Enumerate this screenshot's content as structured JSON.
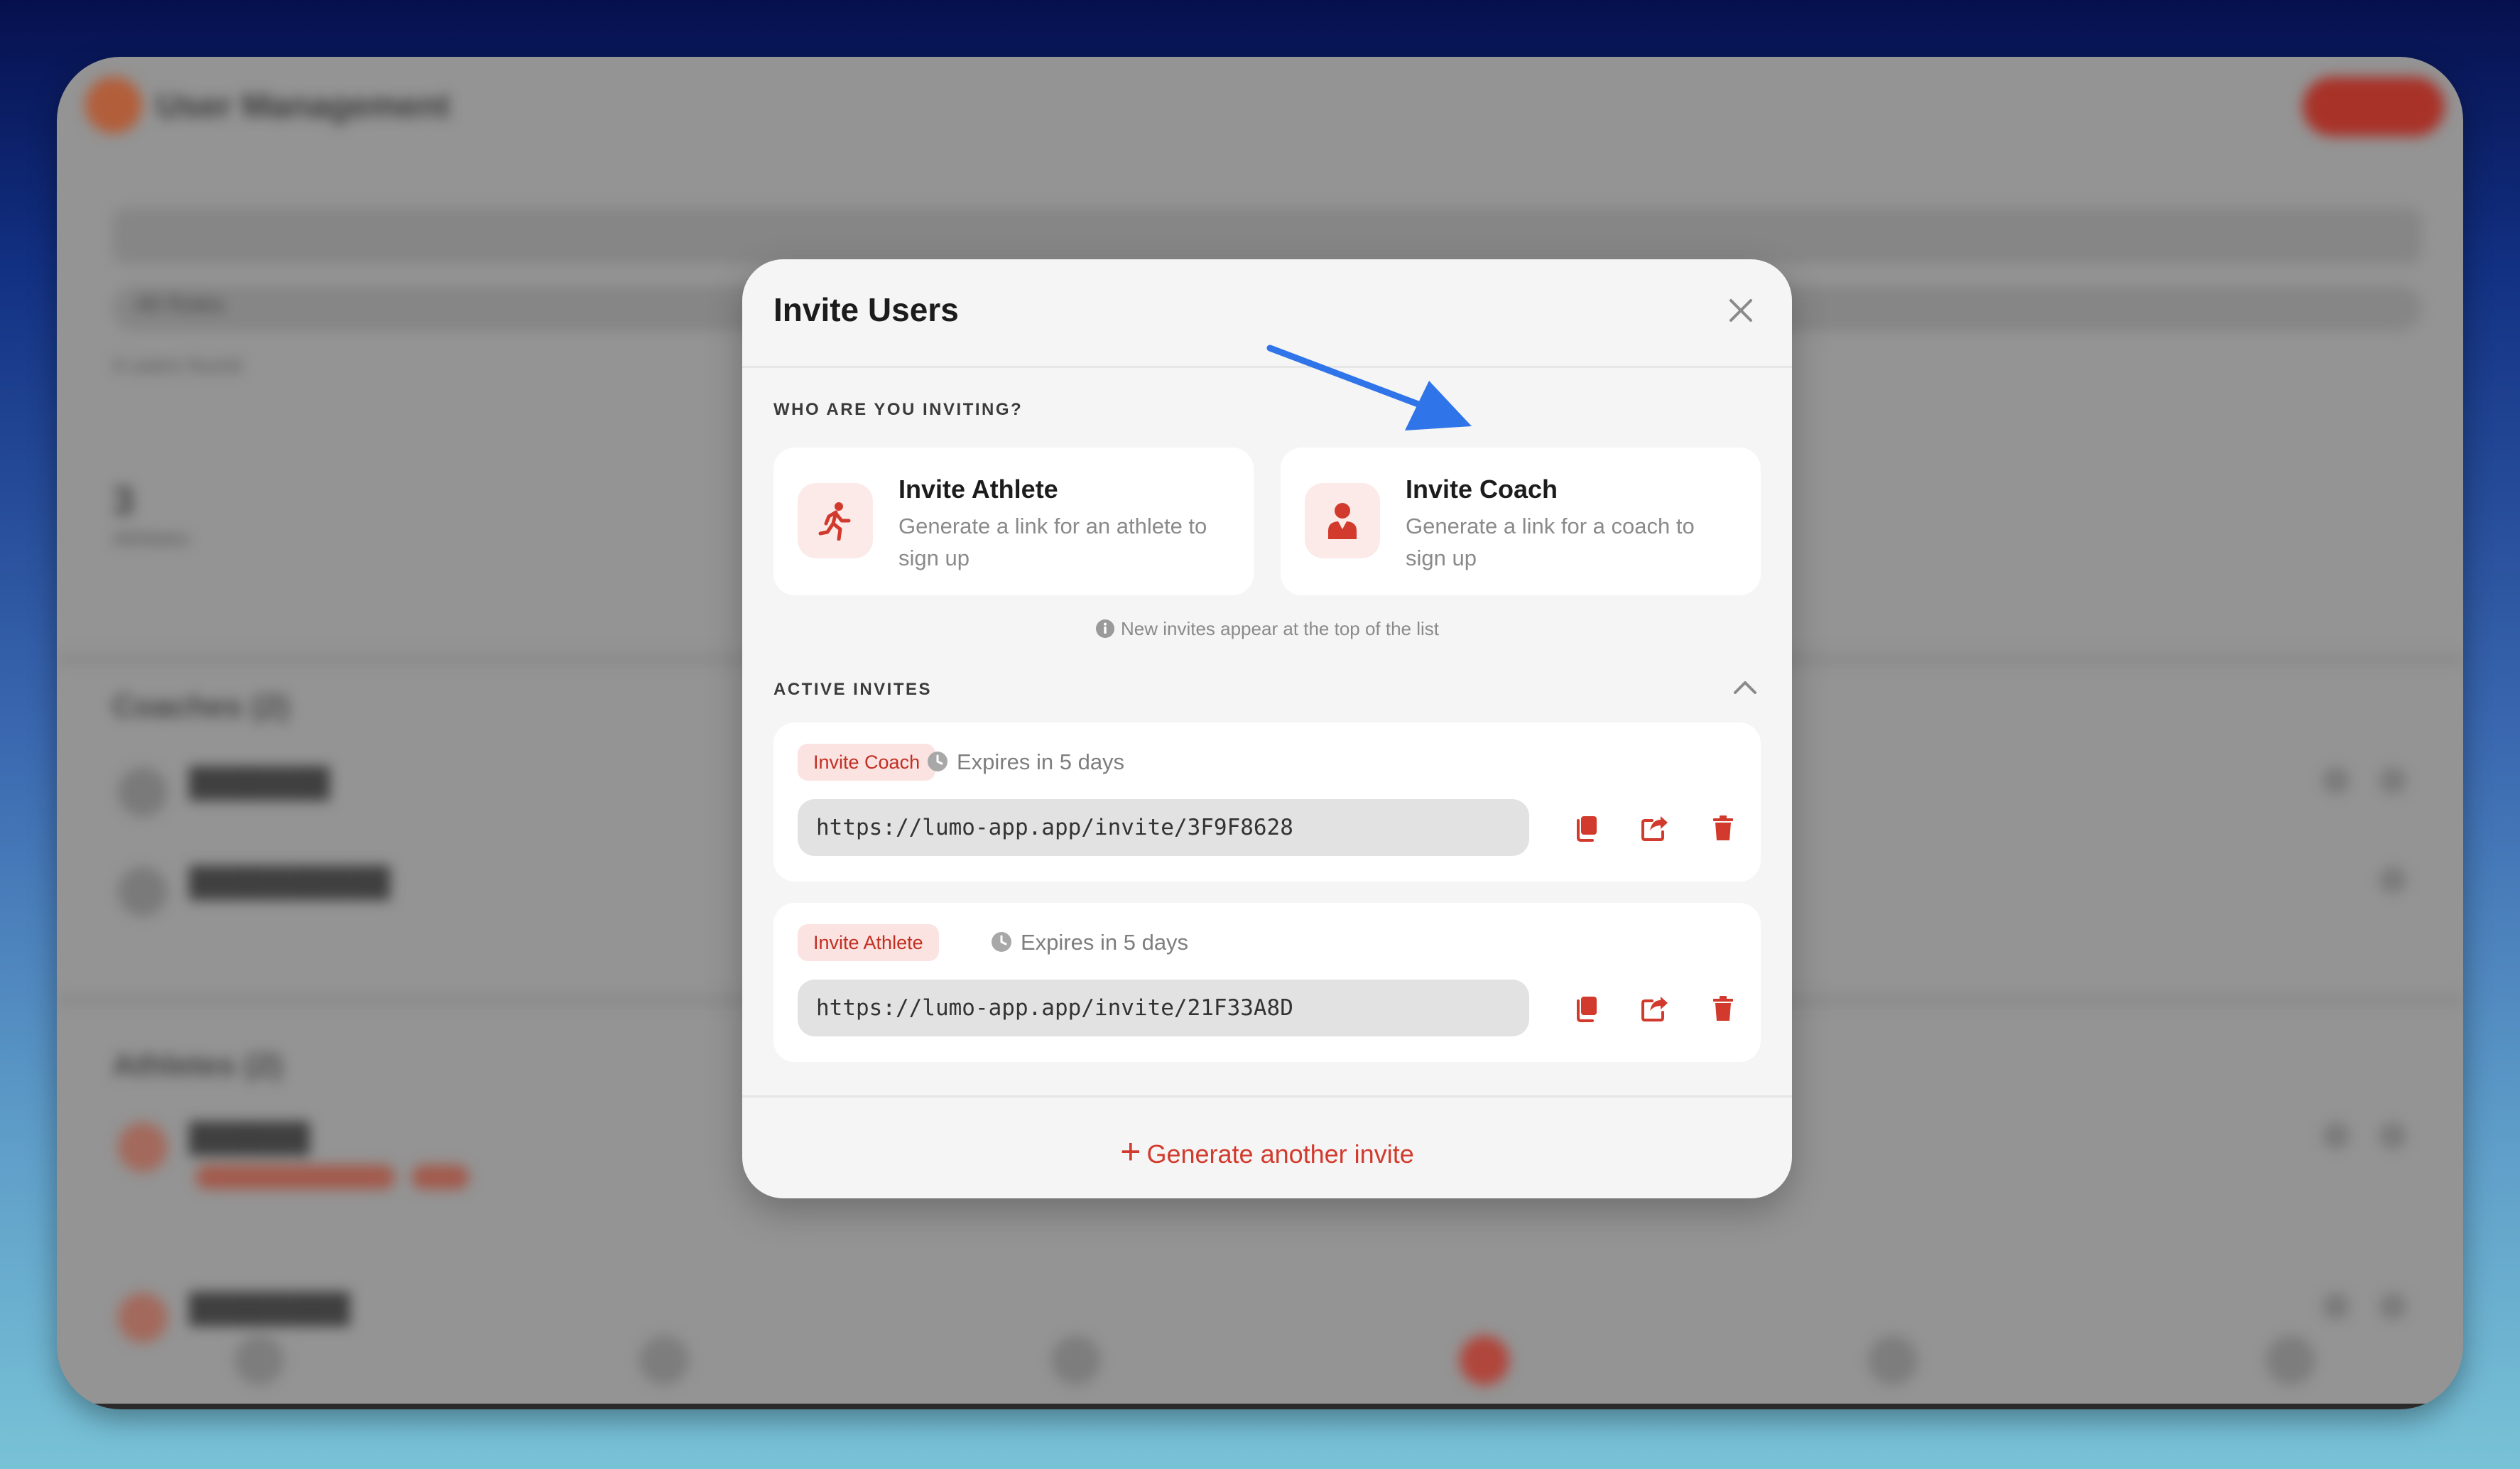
{
  "background_app": {
    "title": "User Management",
    "filter_label": "All Roles",
    "count_label": "4 users found",
    "stat_value": "3",
    "stat_label": "Athletes",
    "coaches_section": "Coaches (2)",
    "athletes_section": "Athletes (2)"
  },
  "modal": {
    "title": "Invite Users",
    "section_label": "WHO ARE YOU INVITING?",
    "choices": [
      {
        "title": "Invite Athlete",
        "description": "Generate a link for an athlete to sign up",
        "icon": "running-person-icon"
      },
      {
        "title": "Invite Coach",
        "description": "Generate a link for a coach to sign up",
        "icon": "person-icon"
      }
    ],
    "hint": "New invites appear at the top of the list",
    "active_label": "ACTIVE INVITES",
    "invites": [
      {
        "tag": "Invite Coach",
        "expires": "Expires in 5 days",
        "url": "https://lumo-app.app/invite/3F9F8628"
      },
      {
        "tag": "Invite Athlete",
        "expires": "Expires in 5 days",
        "url": "https://lumo-app.app/invite/21F33A8D"
      }
    ],
    "generate_label": "Generate another invite"
  },
  "colors": {
    "accent": "#d13a2c",
    "arrow": "#2f74e8",
    "tag_bg": "#fbe3e1"
  }
}
